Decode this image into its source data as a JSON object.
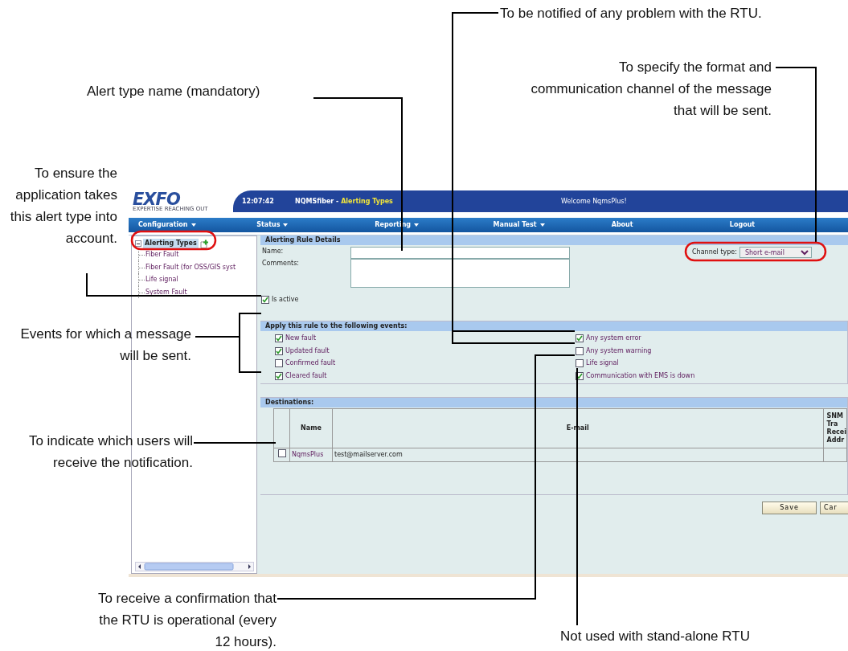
{
  "app": {
    "logo": "EXFO",
    "logo_tagline": "EXPERTISE REACHING OUT",
    "clock": "12:07:42",
    "app_name": "NQMSfiber - ",
    "page_title": "Alerting Types",
    "welcome": "Welcome NqmsPlus!",
    "menu": [
      {
        "label": "Configuration",
        "has_dropdown": true
      },
      {
        "label": "Status",
        "has_dropdown": true
      },
      {
        "label": "Reporting",
        "has_dropdown": true
      },
      {
        "label": "Manual Test",
        "has_dropdown": true
      },
      {
        "label": "About",
        "has_dropdown": false
      },
      {
        "label": "Logout",
        "has_dropdown": false
      }
    ],
    "tree": [
      {
        "label": "Alerting Types",
        "expanded": true,
        "selected": true,
        "children": [
          {
            "label": "Fiber Fault",
            "selected": false
          },
          {
            "label": "Fiber Fault (for OSS/GIS syst",
            "selected": false
          },
          {
            "label": "Life signal",
            "selected": false
          },
          {
            "label": "System Fault",
            "selected": false
          }
        ]
      }
    ],
    "details": {
      "title": "Alerting Rule Details",
      "name_label": "Name:",
      "comments_label": "Comments:",
      "channel_label": "Channel type:",
      "channel_value": "Short e-mail",
      "is_active": {
        "label": "Is active",
        "checked": true
      }
    },
    "events": {
      "title": "Apply this rule to the following events:",
      "columns": [
        [
          {
            "label": "New fault",
            "checked": true
          },
          {
            "label": "Updated fault",
            "checked": true
          },
          {
            "label": "Confirmed fault",
            "checked": false
          },
          {
            "label": "Cleared fault",
            "checked": true
          }
        ],
        [
          {
            "label": "Any system error",
            "checked": true
          },
          {
            "label": "Any system warning",
            "checked": false
          },
          {
            "label": "Life signal",
            "checked": false
          },
          {
            "label": "Communication with EMS is down",
            "checked": true
          }
        ]
      ]
    },
    "destinations": {
      "title": "Destinations:",
      "columns": [
        "Name",
        "E-mail"
      ],
      "column_3": [
        "SNM",
        "Tra",
        "Recei",
        "Addr"
      ],
      "rows": [
        {
          "checked": false,
          "name": "NqmsPlus",
          "email": "test@mailserver.com"
        }
      ]
    },
    "buttons": [
      "Save",
      "Car"
    ]
  },
  "callouts": [
    {
      "text": "To be notified of any problem with the RTU."
    },
    {
      "text": "Alert type name (mandatory)"
    },
    {
      "text": "To specify the format and communication channel of the message that will be sent."
    },
    {
      "text": "To ensure the application takes this alert type into account."
    },
    {
      "text": "Events for which a message will be sent."
    },
    {
      "text": "To indicate which users will receive the notification."
    },
    {
      "text": "To receive a confirmation that the RTU is operational (every 12 hours)."
    },
    {
      "text": "Not used with stand-alone RTU"
    }
  ]
}
